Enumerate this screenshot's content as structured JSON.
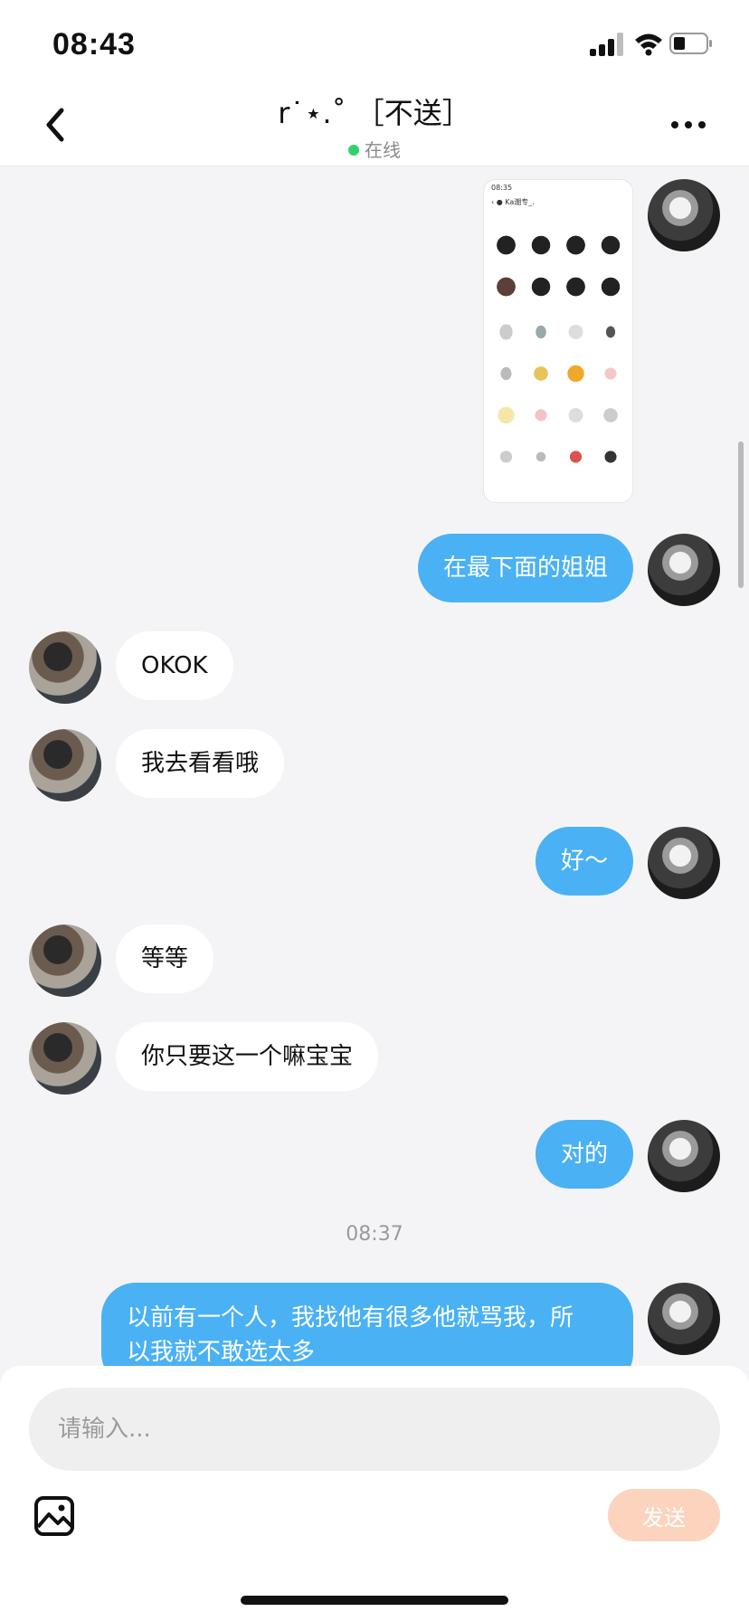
{
  "status_bar": {
    "time": "08:43"
  },
  "nav": {
    "title": "r˙⋆.˚ ［不送］",
    "status": "在线"
  },
  "messages": [
    {
      "type": "image",
      "from": "me",
      "caption_time": "08:35",
      "caption_name": "Ka潮专_."
    },
    {
      "from": "me",
      "text": "在最下面的姐姐"
    },
    {
      "from": "other",
      "text": "OKOK"
    },
    {
      "from": "other",
      "text": "我去看看哦"
    },
    {
      "from": "me",
      "text": "好～"
    },
    {
      "from": "other",
      "text": "等等"
    },
    {
      "from": "other",
      "text": "你只要这一个嘛宝宝"
    },
    {
      "from": "me",
      "text": "对的"
    },
    {
      "type": "timestamp",
      "text": "08:37"
    },
    {
      "from": "me",
      "line1": "以前有一个人，我找他有很多他就骂我，所",
      "line2": "以我就不敢选太多"
    }
  ],
  "composer": {
    "placeholder": "请输入...",
    "send_label": "发送"
  },
  "colors": {
    "bubble_me": "#4ab1f5",
    "bubble_other": "#ffffff",
    "online": "#32d16e",
    "send_disabled": "#fcd3bd"
  }
}
